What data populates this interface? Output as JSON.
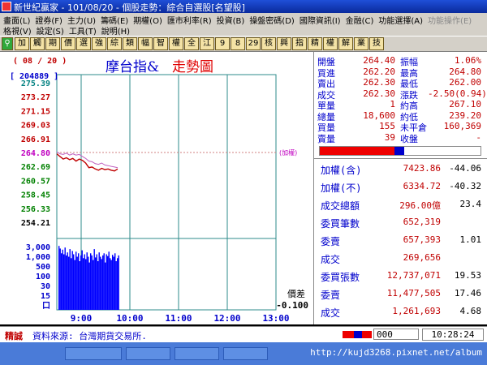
{
  "window": {
    "title": "新世紀贏家 - 101/08/20 - 個股走勢：綜合自選股[名望股]"
  },
  "menu": {
    "row1": [
      "畫面(L)",
      "證券(F)",
      "主力(U)",
      "籌碼(E)",
      "期權(O)",
      "匯市利率(R)",
      "投資(B)",
      "操盤密碼(D)",
      "國際資訊(I)",
      "金融(C)",
      "功能選擇(A)"
    ],
    "row1_disabled": "功能操作(E)",
    "row2": [
      "格視(V)",
      "設定(S)",
      "工具(T)",
      "說明(H)"
    ]
  },
  "toolbar": {
    "buttons": [
      "加",
      "觸",
      "期",
      "價",
      "選",
      "強",
      "綜",
      "類",
      "幅",
      "智",
      "權",
      "全",
      "江",
      "9",
      "8",
      "29",
      "核",
      "興",
      "指",
      "精",
      "權",
      "解",
      "業",
      "技"
    ]
  },
  "chart": {
    "title_a": "摩台指&",
    "title_b": "走勢圖",
    "date_label": "( 08 / 20 )",
    "volume_label": "[ 204889 ]",
    "y_ticks": [
      "275.39",
      "273.27",
      "271.15",
      "269.03",
      "266.91",
      "264.80",
      "262.69",
      "260.57",
      "258.45",
      "256.33",
      "254.21"
    ],
    "vol_ticks": [
      "3,000",
      "1,000",
      "500",
      "100",
      "30",
      "15",
      "口"
    ],
    "x_ticks": [
      "9:00",
      "10:00",
      "11:00",
      "12:00",
      "13:00"
    ],
    "overlay_label": "(加權)",
    "diff_label": "價差",
    "diff_value": "-0.100"
  },
  "chart_data": {
    "type": "line",
    "x_axis_label": "time",
    "y_range": [
      254.21,
      275.39
    ],
    "ref_price": 264.8,
    "x_ticks": [
      "9:00",
      "10:00",
      "11:00",
      "12:00",
      "13:00"
    ],
    "series": [
      {
        "values": [
          264.6,
          264.2,
          263.8,
          264.0,
          263.7,
          263.9,
          263.5,
          263.8,
          263.6,
          263.2,
          262.5,
          262.6,
          262.3,
          262.1,
          262.4,
          262.2,
          262.3,
          262.1,
          262.0,
          262.3
        ]
      },
      {
        "values": [
          264.9,
          264.6,
          264.5,
          264.7,
          264.4,
          264.6,
          264.4,
          264.5,
          264.2,
          263.9,
          263.5,
          263.4,
          263.1,
          263.0,
          263.2,
          262.9,
          262.8,
          262.7,
          262.6,
          262.5
        ]
      }
    ],
    "volume": [
      2200,
      1600,
      900,
      1400,
      800,
      1800,
      700,
      1000,
      600,
      1500,
      500,
      1200,
      800,
      400,
      1100,
      600,
      900,
      350,
      700,
      1300,
      500,
      800,
      450,
      1000,
      600,
      300,
      900,
      700,
      400,
      1500,
      550,
      800,
      350,
      1000,
      600,
      450,
      700,
      900,
      300,
      800,
      650,
      1100,
      500,
      400,
      750,
      600,
      900,
      350,
      500,
      700
    ]
  },
  "quote": [
    {
      "l1": "開盤",
      "v1": "264.40",
      "l2": "振幅",
      "v2": "1.06%"
    },
    {
      "l1": "買進",
      "v1": "262.20",
      "l2": "最高",
      "v2": "264.80"
    },
    {
      "l1": "賣出",
      "v1": "262.30",
      "l2": "最低",
      "v2": "262.00"
    },
    {
      "l1": "成交",
      "v1": "262.30",
      "l2": "漲跌",
      "v2": "-2.50(0.94)"
    },
    {
      "l1": "單量",
      "v1": "1",
      "l2": "約高",
      "v2": "267.10"
    },
    {
      "l1": "總量",
      "v1": "18,600",
      "l2": "約低",
      "v2": "239.20"
    },
    {
      "l1": "買量",
      "v1": "155",
      "l2": "未平倉",
      "v2": "160,369"
    },
    {
      "l1": "賣量",
      "v1": "39",
      "l2": "收盤",
      "v2": "-"
    }
  ],
  "market": [
    {
      "l": "加權(含)",
      "v": "7423.86",
      "c": "-44.06"
    },
    {
      "l": "加權(不)",
      "v": "6334.72",
      "c": "-40.32"
    },
    {
      "l": "成交總額",
      "v": "296.00億",
      "c": "23.4"
    },
    {
      "l": "委買筆數",
      "v": "652,319",
      "c": ""
    },
    {
      "l": "委賣",
      "v": "657,393",
      "c": "1.01"
    },
    {
      "l": "成交",
      "v": "269,656",
      "c": ""
    },
    {
      "l": "委買張數",
      "v": "12,737,071",
      "c": "19.53"
    },
    {
      "l": "委賣",
      "v": "11,477,505",
      "c": "17.46"
    },
    {
      "l": "成交",
      "v": "1,261,693",
      "c": "4.68"
    }
  ],
  "status": {
    "label": "精誠",
    "source": "資料來源: 台灣期貨交易所.",
    "code": "000",
    "time": "10:28:24"
  },
  "bottom": {
    "url": "http://kujd3268.pixnet.net/album"
  },
  "colors": {
    "accent": "#0000cc",
    "up": "#c00000",
    "volume": "#0000ff",
    "grid": "#2e8b8b"
  }
}
